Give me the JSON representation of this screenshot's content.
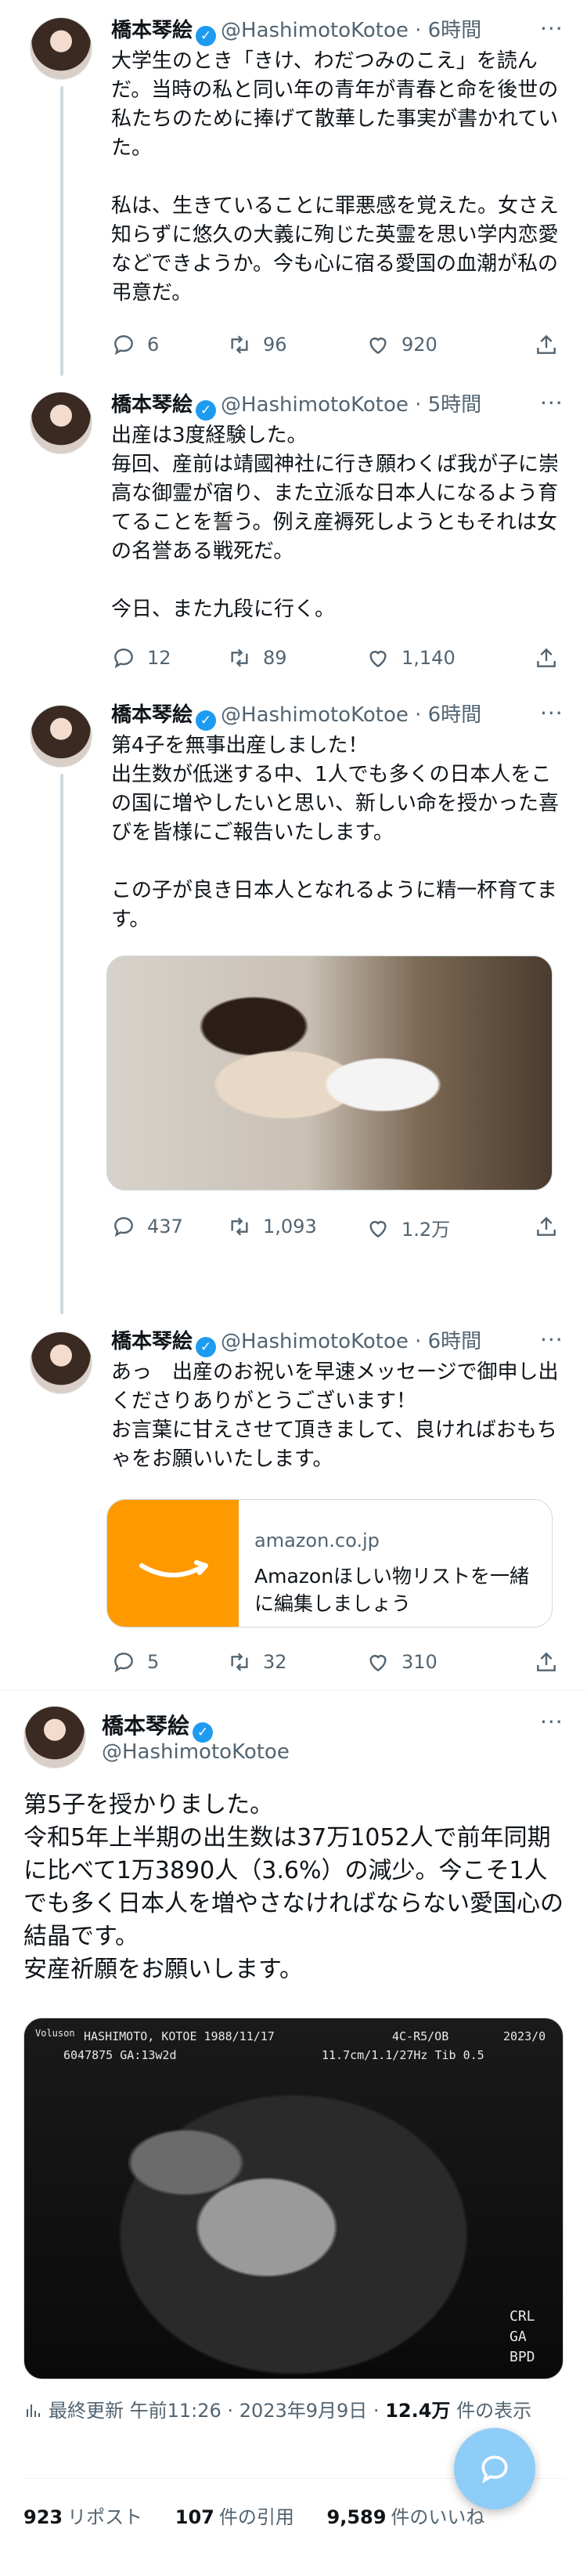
{
  "tweets": [
    {
      "name": "橋本琴絵",
      "handle": "@HashimotoKotoe · 6時間",
      "text": "大学生のとき「きけ、わだつみのこえ」を読んだ。当時の私と同い年の青年が青春と命を後世の私たちのために捧げて散華した事実が書かれていた。\n\n私は、生きていることに罪悪感を覚えた。女さえ知らずに悠久の大義に殉じた英霊を思い学内恋愛などできようか。今も心に宿る愛国の血潮が私の弔意だ。",
      "replies": "6",
      "retweets": "96",
      "likes": "920"
    },
    {
      "name": "橋本琴絵",
      "handle": "@HashimotoKotoe · 5時間",
      "text": "出産は3度経験した。\n毎回、産前は靖國神社に行き願わくば我が子に崇高な御霊が宿り、また立派な日本人になるよう育てることを誓う。例え産褥死しようともそれは女の名誉ある戦死だ。\n\n今日、また九段に行く。",
      "replies": "12",
      "retweets": "89",
      "likes": "1,140"
    },
    {
      "name": "橋本琴絵",
      "handle": "@HashimotoKotoe · 6時間",
      "text": "第4子を無事出産しました！\n出生数が低迷する中、1人でも多くの日本人をこの国に増やしたいと思い、新しい命を授かった喜びを皆様にご報告いたします。\n\nこの子が良き日本人となれるように精一杯育てます。",
      "replies": "437",
      "retweets": "1,093",
      "likes": "1.2万"
    },
    {
      "name": "橋本琴絵",
      "handle": "@HashimotoKotoe · 6時間",
      "text": "あっ　出産のお祝いを早速メッセージで御申し出くださりありがとうございます！\nお言葉に甘えさせて頂きまして、良ければおもちゃをお願いいたします。",
      "replies": "5",
      "retweets": "32",
      "likes": "310",
      "card": {
        "domain": "amazon.co.jp",
        "title": "Amazonほしい物リストを一緒に編集しましょう"
      }
    }
  ],
  "focus": {
    "name": "橋本琴絵",
    "handle": "@HashimotoKotoe",
    "text": "第5子を授かりました。\n令和5年上半期の出生数は37万1052人で前年同期に比べて1万3890人（3.6%）の減少。今こそ1人でも多く日本人を増やさなければならない愛国心の結晶です。\n安産祈願をお願いします。",
    "ultrasound": {
      "header_left": "HASHIMOTO, KOTOE 1988/11/17",
      "header_right": "4C-R5/OB",
      "params": "11.7cm/1.1/27Hz  Tib 0.5",
      "id_line": "6047875 GA:13w2d",
      "corner_labels": [
        "CRL",
        "GA",
        "BPD"
      ],
      "year": "2023/0",
      "brand": "Voluson"
    },
    "meta_prefix": "最終更新",
    "meta_time": "午前11:26 · 2023年9月9日 ·",
    "meta_views": "12.4万",
    "meta_views_suffix": "件の表示",
    "stats": {
      "retweets_num": "923",
      "retweets_label": "リポスト",
      "quotes_num": "107",
      "quotes_label": "件の引用",
      "likes_num": "9,589",
      "likes_label": "件のいいね"
    }
  },
  "icons": {
    "reply": "reply-icon",
    "retweet": "retweet-icon",
    "like": "heart-icon",
    "share": "share-icon",
    "more": "more-icon",
    "verified": "verified-badge-icon",
    "views": "views-icon",
    "compose": "compose-icon"
  },
  "colors": {
    "accent": "#1d9bf0",
    "muted": "#536471",
    "text": "#0f1419",
    "amazon": "#ff9900"
  }
}
